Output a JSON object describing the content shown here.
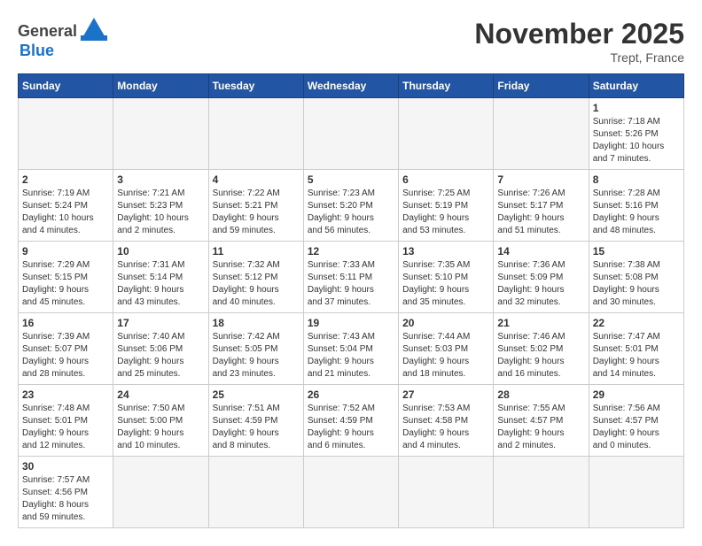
{
  "header": {
    "logo_general": "General",
    "logo_blue": "Blue",
    "month_title": "November 2025",
    "location": "Trept, France"
  },
  "weekdays": [
    "Sunday",
    "Monday",
    "Tuesday",
    "Wednesday",
    "Thursday",
    "Friday",
    "Saturday"
  ],
  "days": [
    {
      "date": "",
      "info": ""
    },
    {
      "date": "",
      "info": ""
    },
    {
      "date": "",
      "info": ""
    },
    {
      "date": "",
      "info": ""
    },
    {
      "date": "",
      "info": ""
    },
    {
      "date": "",
      "info": ""
    },
    {
      "date": "1",
      "info": "Sunrise: 7:18 AM\nSunset: 5:26 PM\nDaylight: 10 hours\nand 7 minutes."
    },
    {
      "date": "2",
      "info": "Sunrise: 7:19 AM\nSunset: 5:24 PM\nDaylight: 10 hours\nand 4 minutes."
    },
    {
      "date": "3",
      "info": "Sunrise: 7:21 AM\nSunset: 5:23 PM\nDaylight: 10 hours\nand 2 minutes."
    },
    {
      "date": "4",
      "info": "Sunrise: 7:22 AM\nSunset: 5:21 PM\nDaylight: 9 hours\nand 59 minutes."
    },
    {
      "date": "5",
      "info": "Sunrise: 7:23 AM\nSunset: 5:20 PM\nDaylight: 9 hours\nand 56 minutes."
    },
    {
      "date": "6",
      "info": "Sunrise: 7:25 AM\nSunset: 5:19 PM\nDaylight: 9 hours\nand 53 minutes."
    },
    {
      "date": "7",
      "info": "Sunrise: 7:26 AM\nSunset: 5:17 PM\nDaylight: 9 hours\nand 51 minutes."
    },
    {
      "date": "8",
      "info": "Sunrise: 7:28 AM\nSunset: 5:16 PM\nDaylight: 9 hours\nand 48 minutes."
    },
    {
      "date": "9",
      "info": "Sunrise: 7:29 AM\nSunset: 5:15 PM\nDaylight: 9 hours\nand 45 minutes."
    },
    {
      "date": "10",
      "info": "Sunrise: 7:31 AM\nSunset: 5:14 PM\nDaylight: 9 hours\nand 43 minutes."
    },
    {
      "date": "11",
      "info": "Sunrise: 7:32 AM\nSunset: 5:12 PM\nDaylight: 9 hours\nand 40 minutes."
    },
    {
      "date": "12",
      "info": "Sunrise: 7:33 AM\nSunset: 5:11 PM\nDaylight: 9 hours\nand 37 minutes."
    },
    {
      "date": "13",
      "info": "Sunrise: 7:35 AM\nSunset: 5:10 PM\nDaylight: 9 hours\nand 35 minutes."
    },
    {
      "date": "14",
      "info": "Sunrise: 7:36 AM\nSunset: 5:09 PM\nDaylight: 9 hours\nand 32 minutes."
    },
    {
      "date": "15",
      "info": "Sunrise: 7:38 AM\nSunset: 5:08 PM\nDaylight: 9 hours\nand 30 minutes."
    },
    {
      "date": "16",
      "info": "Sunrise: 7:39 AM\nSunset: 5:07 PM\nDaylight: 9 hours\nand 28 minutes."
    },
    {
      "date": "17",
      "info": "Sunrise: 7:40 AM\nSunset: 5:06 PM\nDaylight: 9 hours\nand 25 minutes."
    },
    {
      "date": "18",
      "info": "Sunrise: 7:42 AM\nSunset: 5:05 PM\nDaylight: 9 hours\nand 23 minutes."
    },
    {
      "date": "19",
      "info": "Sunrise: 7:43 AM\nSunset: 5:04 PM\nDaylight: 9 hours\nand 21 minutes."
    },
    {
      "date": "20",
      "info": "Sunrise: 7:44 AM\nSunset: 5:03 PM\nDaylight: 9 hours\nand 18 minutes."
    },
    {
      "date": "21",
      "info": "Sunrise: 7:46 AM\nSunset: 5:02 PM\nDaylight: 9 hours\nand 16 minutes."
    },
    {
      "date": "22",
      "info": "Sunrise: 7:47 AM\nSunset: 5:01 PM\nDaylight: 9 hours\nand 14 minutes."
    },
    {
      "date": "23",
      "info": "Sunrise: 7:48 AM\nSunset: 5:01 PM\nDaylight: 9 hours\nand 12 minutes."
    },
    {
      "date": "24",
      "info": "Sunrise: 7:50 AM\nSunset: 5:00 PM\nDaylight: 9 hours\nand 10 minutes."
    },
    {
      "date": "25",
      "info": "Sunrise: 7:51 AM\nSunset: 4:59 PM\nDaylight: 9 hours\nand 8 minutes."
    },
    {
      "date": "26",
      "info": "Sunrise: 7:52 AM\nSunset: 4:59 PM\nDaylight: 9 hours\nand 6 minutes."
    },
    {
      "date": "27",
      "info": "Sunrise: 7:53 AM\nSunset: 4:58 PM\nDaylight: 9 hours\nand 4 minutes."
    },
    {
      "date": "28",
      "info": "Sunrise: 7:55 AM\nSunset: 4:57 PM\nDaylight: 9 hours\nand 2 minutes."
    },
    {
      "date": "29",
      "info": "Sunrise: 7:56 AM\nSunset: 4:57 PM\nDaylight: 9 hours\nand 0 minutes."
    },
    {
      "date": "30",
      "info": "Sunrise: 7:57 AM\nSunset: 4:56 PM\nDaylight: 8 hours\nand 59 minutes."
    }
  ]
}
